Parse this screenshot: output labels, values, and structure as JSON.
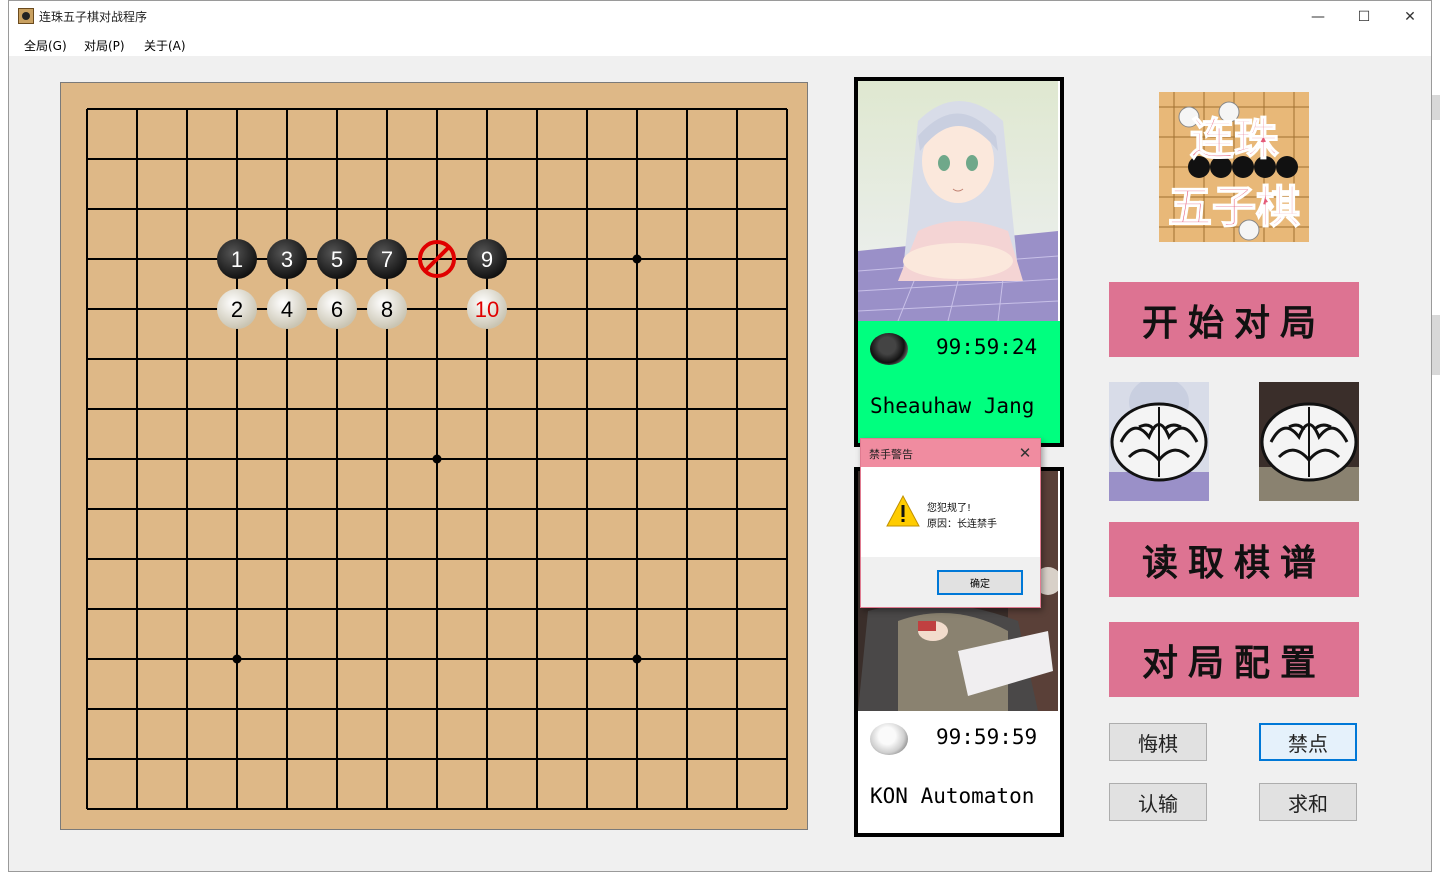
{
  "window": {
    "title": "连珠五子棋对战程序",
    "controls": {
      "minimize": "—",
      "maximize": "☐",
      "close": "✕"
    }
  },
  "menu": {
    "items": [
      "全局(G)",
      "对局(P)",
      "关于(A)"
    ]
  },
  "board": {
    "size": 15,
    "star_points": [
      [
        3,
        3
      ],
      [
        11,
        3
      ],
      [
        7,
        7
      ],
      [
        3,
        11
      ],
      [
        11,
        11
      ]
    ],
    "stones": [
      {
        "n": "1",
        "color": "black",
        "col": 3,
        "row": 3
      },
      {
        "n": "2",
        "color": "white",
        "col": 3,
        "row": 4
      },
      {
        "n": "3",
        "color": "black",
        "col": 4,
        "row": 3
      },
      {
        "n": "4",
        "color": "white",
        "col": 4,
        "row": 4
      },
      {
        "n": "5",
        "color": "black",
        "col": 5,
        "row": 3
      },
      {
        "n": "6",
        "color": "white",
        "col": 5,
        "row": 4
      },
      {
        "n": "7",
        "color": "black",
        "col": 6,
        "row": 3
      },
      {
        "n": "8",
        "color": "white",
        "col": 6,
        "row": 4
      },
      {
        "n": "9",
        "color": "black",
        "col": 8,
        "row": 3
      },
      {
        "n": "10",
        "color": "white",
        "col": 8,
        "row": 4,
        "highlight": true
      }
    ],
    "forbidden_point": {
      "col": 7,
      "row": 3
    }
  },
  "players": {
    "black": {
      "timer": "99:59:24",
      "name": "Sheauhaw Jang",
      "active": true
    },
    "white": {
      "timer": "99:59:59",
      "name": "KON Automaton",
      "active": false
    }
  },
  "logo": {
    "line1": "连珠",
    "line2": "五子棋"
  },
  "buttons": {
    "start": "开始对局",
    "load": "读取棋谱",
    "config": "对局配置",
    "undo": "悔棋",
    "forbidden": "禁点",
    "resign": "认输",
    "draw": "求和"
  },
  "dialog": {
    "title": "禁手警告",
    "line1": "您犯规了!",
    "line2": "原因：长连禁手",
    "ok": "确定"
  },
  "colors": {
    "board": "#deb887",
    "active_panel": "#00ff7f",
    "accent_button": "#dd7392",
    "dialog_title": "#f08ca0"
  }
}
